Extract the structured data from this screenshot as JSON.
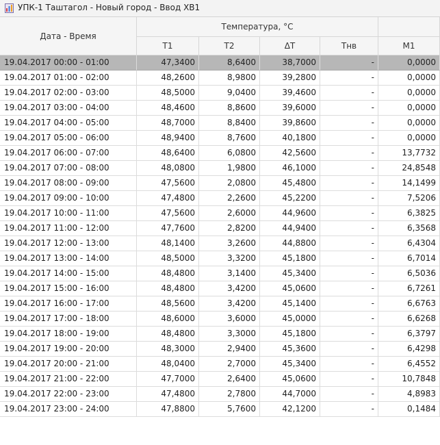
{
  "window": {
    "title": "УПК-1 Таштагол - Новый город - Ввод ХВ1",
    "icon": "chart-icon"
  },
  "table": {
    "headers": {
      "datetime": "Дата - Время",
      "temperature_group": "Температура, °C",
      "t1": "T1",
      "t2": "T2",
      "dt": "ΔT",
      "thv": "Тнв",
      "m1": "M1"
    },
    "selected_row": 0,
    "rows": [
      {
        "datetime": "19.04.2017 00:00 - 01:00",
        "t1": "47,3400",
        "t2": "8,6400",
        "dt": "38,7000",
        "thv": "-",
        "m1": "0,0000"
      },
      {
        "datetime": "19.04.2017 01:00 - 02:00",
        "t1": "48,2600",
        "t2": "8,9800",
        "dt": "39,2800",
        "thv": "-",
        "m1": "0,0000"
      },
      {
        "datetime": "19.04.2017 02:00 - 03:00",
        "t1": "48,5000",
        "t2": "9,0400",
        "dt": "39,4600",
        "thv": "-",
        "m1": "0,0000"
      },
      {
        "datetime": "19.04.2017 03:00 - 04:00",
        "t1": "48,4600",
        "t2": "8,8600",
        "dt": "39,6000",
        "thv": "-",
        "m1": "0,0000"
      },
      {
        "datetime": "19.04.2017 04:00 - 05:00",
        "t1": "48,7000",
        "t2": "8,8400",
        "dt": "39,8600",
        "thv": "-",
        "m1": "0,0000"
      },
      {
        "datetime": "19.04.2017 05:00 - 06:00",
        "t1": "48,9400",
        "t2": "8,7600",
        "dt": "40,1800",
        "thv": "-",
        "m1": "0,0000"
      },
      {
        "datetime": "19.04.2017 06:00 - 07:00",
        "t1": "48,6400",
        "t2": "6,0800",
        "dt": "42,5600",
        "thv": "-",
        "m1": "13,7732"
      },
      {
        "datetime": "19.04.2017 07:00 - 08:00",
        "t1": "48,0800",
        "t2": "1,9800",
        "dt": "46,1000",
        "thv": "-",
        "m1": "24,8548"
      },
      {
        "datetime": "19.04.2017 08:00 - 09:00",
        "t1": "47,5600",
        "t2": "2,0800",
        "dt": "45,4800",
        "thv": "-",
        "m1": "14,1499"
      },
      {
        "datetime": "19.04.2017 09:00 - 10:00",
        "t1": "47,4800",
        "t2": "2,2600",
        "dt": "45,2200",
        "thv": "-",
        "m1": "7,5206"
      },
      {
        "datetime": "19.04.2017 10:00 - 11:00",
        "t1": "47,5600",
        "t2": "2,6000",
        "dt": "44,9600",
        "thv": "-",
        "m1": "6,3825"
      },
      {
        "datetime": "19.04.2017 11:00 - 12:00",
        "t1": "47,7600",
        "t2": "2,8200",
        "dt": "44,9400",
        "thv": "-",
        "m1": "6,3568"
      },
      {
        "datetime": "19.04.2017 12:00 - 13:00",
        "t1": "48,1400",
        "t2": "3,2600",
        "dt": "44,8800",
        "thv": "-",
        "m1": "6,4304"
      },
      {
        "datetime": "19.04.2017 13:00 - 14:00",
        "t1": "48,5000",
        "t2": "3,3200",
        "dt": "45,1800",
        "thv": "-",
        "m1": "6,7014"
      },
      {
        "datetime": "19.04.2017 14:00 - 15:00",
        "t1": "48,4800",
        "t2": "3,1400",
        "dt": "45,3400",
        "thv": "-",
        "m1": "6,5036"
      },
      {
        "datetime": "19.04.2017 15:00 - 16:00",
        "t1": "48,4800",
        "t2": "3,4200",
        "dt": "45,0600",
        "thv": "-",
        "m1": "6,7261"
      },
      {
        "datetime": "19.04.2017 16:00 - 17:00",
        "t1": "48,5600",
        "t2": "3,4200",
        "dt": "45,1400",
        "thv": "-",
        "m1": "6,6763"
      },
      {
        "datetime": "19.04.2017 17:00 - 18:00",
        "t1": "48,6000",
        "t2": "3,6000",
        "dt": "45,0000",
        "thv": "-",
        "m1": "6,6268"
      },
      {
        "datetime": "19.04.2017 18:00 - 19:00",
        "t1": "48,4800",
        "t2": "3,3000",
        "dt": "45,1800",
        "thv": "-",
        "m1": "6,3797"
      },
      {
        "datetime": "19.04.2017 19:00 - 20:00",
        "t1": "48,3000",
        "t2": "2,9400",
        "dt": "45,3600",
        "thv": "-",
        "m1": "6,4298"
      },
      {
        "datetime": "19.04.2017 20:00 - 21:00",
        "t1": "48,0400",
        "t2": "2,7000",
        "dt": "45,3400",
        "thv": "-",
        "m1": "6,4552"
      },
      {
        "datetime": "19.04.2017 21:00 - 22:00",
        "t1": "47,7000",
        "t2": "2,6400",
        "dt": "45,0600",
        "thv": "-",
        "m1": "10,7848"
      },
      {
        "datetime": "19.04.2017 22:00 - 23:00",
        "t1": "47,4800",
        "t2": "2,7800",
        "dt": "44,7000",
        "thv": "-",
        "m1": "4,8983"
      },
      {
        "datetime": "19.04.2017 23:00 - 24:00",
        "t1": "47,8800",
        "t2": "5,7600",
        "dt": "42,1200",
        "thv": "-",
        "m1": "0,1484"
      }
    ]
  }
}
